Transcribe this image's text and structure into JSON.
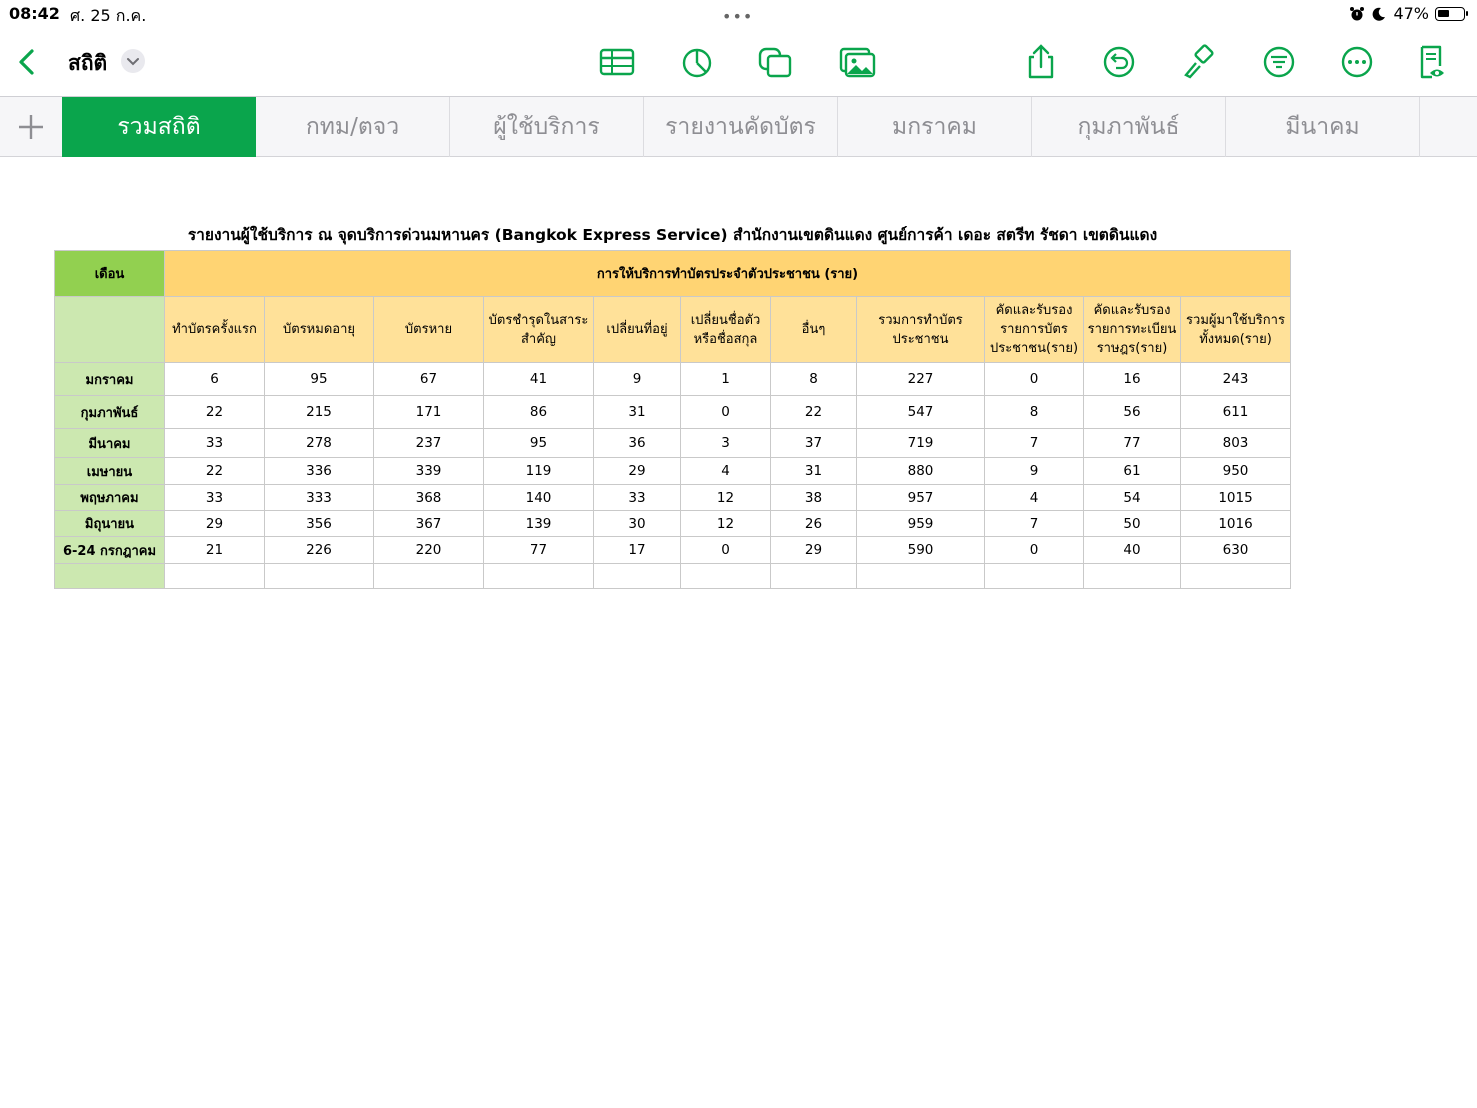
{
  "status_bar": {
    "time": "08:42",
    "date": "ศ. 25 ก.ค.",
    "dots": "•••",
    "battery": "47%",
    "battery_level": 0.47
  },
  "toolbar": {
    "title": "สถิติ",
    "accent_color": "#0aa54c",
    "icons": [
      "back-chevron-icon",
      "title-dropdown-icon",
      "table-icon",
      "chart-icon",
      "shape-icon",
      "media-icon",
      "share-icon",
      "undo-icon",
      "format-brush-icon",
      "sort-filter-icon",
      "more-icon",
      "reader-view-icon"
    ]
  },
  "tabs": [
    {
      "label": "รวมสถิติ",
      "active": true
    },
    {
      "label": "กทม/ตจว",
      "active": false
    },
    {
      "label": "ผู้ใช้บริการ",
      "active": false
    },
    {
      "label": "รายงานคัดบัตร",
      "active": false
    },
    {
      "label": "มกราคม",
      "active": false
    },
    {
      "label": "กุมภาพันธ์",
      "active": false
    },
    {
      "label": "มีนาคม",
      "active": false
    }
  ],
  "sheet": {
    "title": "รายงานผู้ใช้บริการ ณ จุดบริการด่วนมหานคร (Bangkok Express Service) สำนักงานเขตดินแดง ศูนย์การค้า เดอะ สตรีท รัชดา เขตดินแดง",
    "month_header": "เดือน",
    "group_header": "การให้บริการทำบัตรประจำตัวประชาชน (ราย)",
    "columns": [
      "ทำบัตรครั้งแรก",
      "บัตรหมดอายุ",
      "บัตรหาย",
      "บัตรชำรุดในสาระ\nสำคัญ",
      "เปลี่ยนที่อยู่",
      "เปลี่ยนชื่อตัว\nหรือชื่อสกุล",
      "อื่นๆ",
      "รวมการทำบัตร\nประชาชน",
      "คัดและรับรอง\nรายการบัตร\nประชาชน(ราย)",
      "คัดและรับรอง\nรายการทะเบียน\nราษฎร(ราย)",
      "รวมผู้มาใช้บริการ\nทั้งหมด(ราย)"
    ],
    "rows": [
      {
        "month": "มกราคม",
        "values": [
          "6",
          "95",
          "67",
          "41",
          "9",
          "1",
          "8",
          "227",
          "0",
          "16",
          "243"
        ]
      },
      {
        "month": "กุมภาพันธ์",
        "values": [
          "22",
          "215",
          "171",
          "86",
          "31",
          "0",
          "22",
          "547",
          "8",
          "56",
          "611"
        ]
      },
      {
        "month": "มีนาคม",
        "values": [
          "33",
          "278",
          "237",
          "95",
          "36",
          "3",
          "37",
          "719",
          "7",
          "77",
          "803"
        ]
      },
      {
        "month": "เมษายน",
        "values": [
          "22",
          "336",
          "339",
          "119",
          "29",
          "4",
          "31",
          "880",
          "9",
          "61",
          "950"
        ]
      },
      {
        "month": "พฤษภาคม",
        "values": [
          "33",
          "333",
          "368",
          "140",
          "33",
          "12",
          "38",
          "957",
          "4",
          "54",
          "1015"
        ]
      },
      {
        "month": "มิถุนายน",
        "values": [
          "29",
          "356",
          "367",
          "139",
          "30",
          "12",
          "26",
          "959",
          "7",
          "50",
          "1016"
        ]
      },
      {
        "month": "6-24 กรกฎาคม",
        "values": [
          "21",
          "226",
          "220",
          "77",
          "17",
          "0",
          "29",
          "590",
          "0",
          "40",
          "630"
        ]
      },
      {
        "month": "",
        "values": [
          "",
          "",
          "",
          "",
          "",
          "",
          "",
          "",
          "",
          "",
          ""
        ]
      }
    ]
  }
}
